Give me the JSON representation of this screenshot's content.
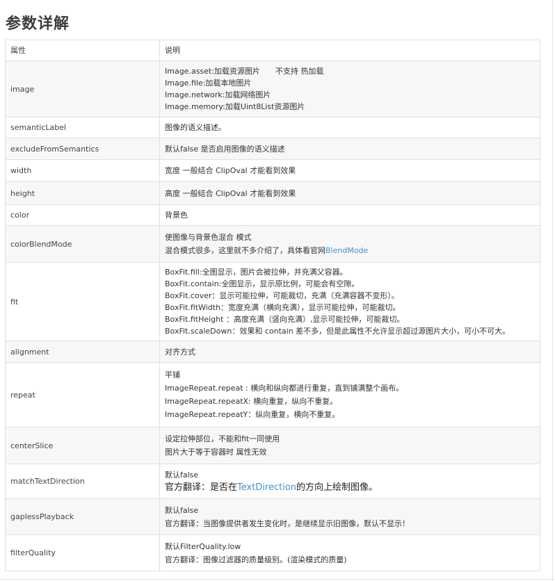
{
  "page_title": "参数详解",
  "header": {
    "name": "属性",
    "desc": "说明"
  },
  "rows": [
    {
      "name": "image",
      "lines": [
        "Image.asset:加载资源图片　　不支持 热加载",
        "Image.file:加载本地图片",
        "Image.network:加载网络图片",
        "Image.memory:加载Uint8List资源图片"
      ]
    },
    {
      "name": "semanticLabel",
      "lines": [
        "图像的语义描述。"
      ]
    },
    {
      "name": "excludeFromSemantics",
      "lines": [
        "默认false  是否启用图像的语义描述"
      ]
    },
    {
      "name": "width",
      "lines": [
        "宽度 一般结合 ClipOval 才能看到效果"
      ]
    },
    {
      "name": "height",
      "lines": [
        "高度 一般结合 ClipOval 才能看到效果"
      ]
    },
    {
      "name": "color",
      "lines": [
        "背景色"
      ]
    },
    {
      "name": "colorBlendMode",
      "lines": [
        "使图像与背景色混合 模式",
        "混合模式很多，这里就不多介绍了，具体看官网"
      ],
      "link": "BlendMode"
    },
    {
      "name": "fit",
      "lines": [
        "BoxFit.fill:全图显示，图片会被拉伸，并充满父容器。",
        "BoxFit.contain:全图显示，显示原比例，可能会有空隙。",
        "BoxFit.cover：显示可能拉伸，可能裁切，充满（充满容器不变形）。",
        "BoxFit.fitWidth：宽度充满（横向充满），显示可能拉伸，可能裁切。",
        "BoxFit.fitHeight ：高度充满（竖向充满）,显示可能拉伸，可能裁切。",
        "BoxFit.scaleDown：效果和 contain 差不多，但是此属性不允许显示超过源图片大小，可小不可大。"
      ]
    },
    {
      "name": "alignment",
      "lines": [
        "对齐方式"
      ]
    },
    {
      "name": "repeat",
      "lines": [
        "平铺",
        "ImageRepeat.repeat : 横向和纵向都进行重复，直到铺满整个画布。",
        "ImageRepeat.repeatX: 横向重复，纵向不重复。",
        "ImageRepeat.repeatY：纵向重复，横向不重复。"
      ]
    },
    {
      "name": "centerSlice",
      "lines": [
        "设定拉伸部位，不能和fit一同使用",
        "图片大于等于容器时 属性无效"
      ]
    },
    {
      "name": "matchTextDirection",
      "lines": [
        "默认false"
      ],
      "line2_prefix": "官方翻译：是否在",
      "link": "TextDirection",
      "line2_suffix": "的方向上绘制图像。"
    },
    {
      "name": "gaplessPlayback",
      "lines": [
        "默认false",
        "官方翻译：当图像提供者发生变化时，是继续显示旧图像，默认不显示！"
      ]
    },
    {
      "name": "filterQuality",
      "lines": [
        "默认FilterQuality.low",
        "官方翻译：图像过滤器的质量级别。(渲染模式的质量)"
      ]
    }
  ],
  "colors": {
    "link": "#4a90c8",
    "row_alt_bg": "#f7f7f7",
    "border": "#dfdfdf"
  }
}
